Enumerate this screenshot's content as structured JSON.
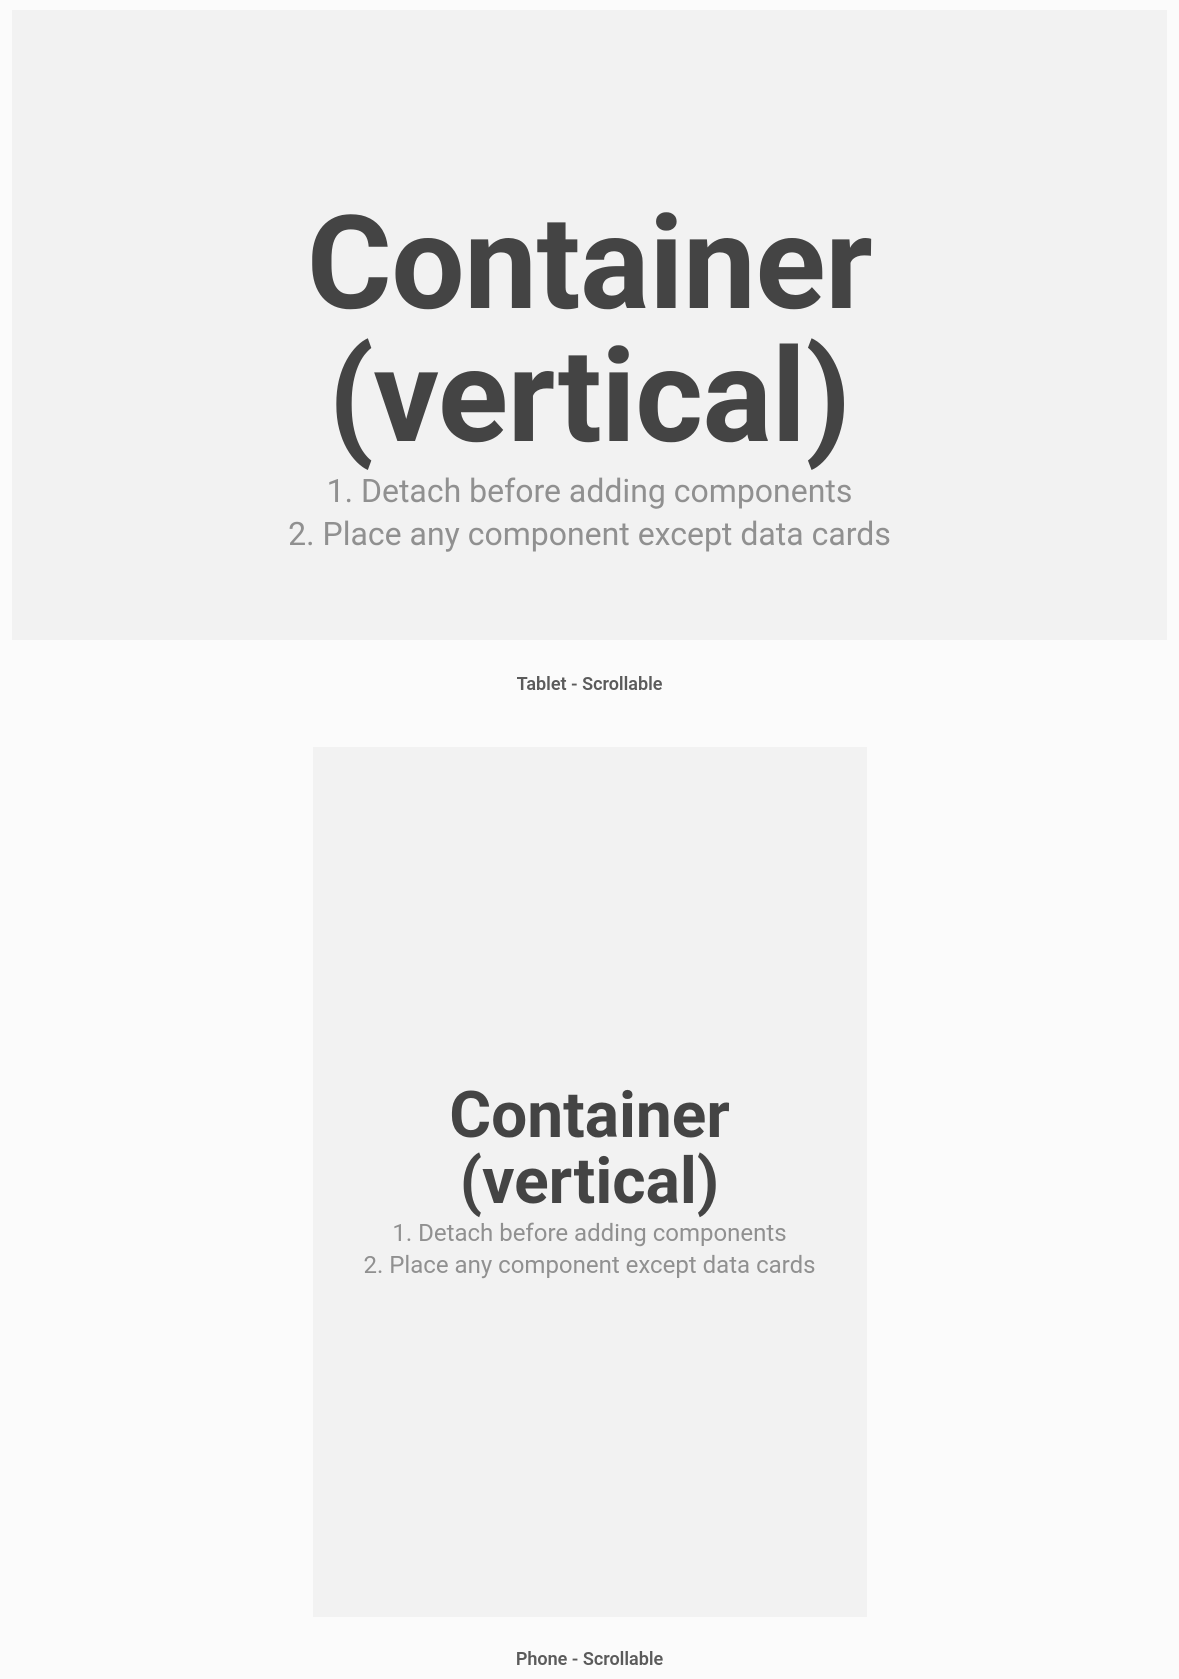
{
  "top": {
    "title_line1": "Container",
    "title_line2": "(vertical)",
    "instruction1": "1. Detach before adding components",
    "instruction2": "2. Place any component except data cards"
  },
  "top_caption": "Tablet - Scrollable",
  "phone": {
    "title_line1": "Container",
    "title_line2": "(vertical)",
    "instruction1": "1. Detach before adding components",
    "instruction2": "2. Place any component except data cards"
  },
  "phone_caption": "Phone - Scrollable"
}
